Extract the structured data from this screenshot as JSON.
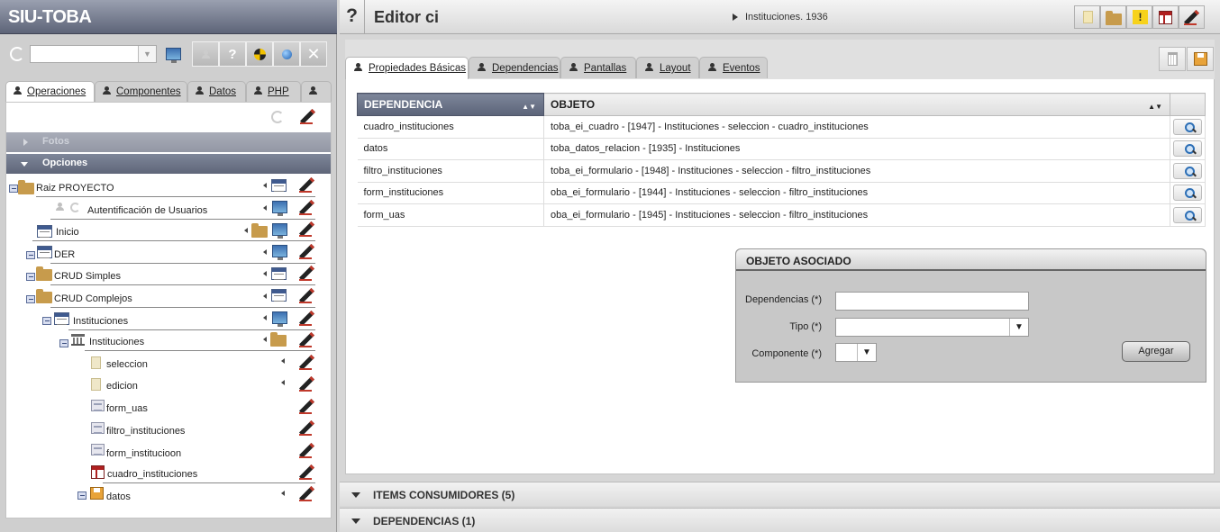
{
  "app": {
    "brand": "SIU-TOBA"
  },
  "left": {
    "tabs": [
      "Operaciones",
      "Componentes",
      "Datos",
      "PHP"
    ],
    "sections": {
      "fotos": "Fotos",
      "opciones": "Opciones"
    },
    "tree": [
      {
        "label": "Raiz PROYECTO"
      },
      {
        "label": "Autentificación de Usuarios"
      },
      {
        "label": "Inicio"
      },
      {
        "label": "DER"
      },
      {
        "label": "CRUD Simples"
      },
      {
        "label": "CRUD Complejos"
      },
      {
        "label": "Instituciones"
      },
      {
        "label": "Instituciones"
      },
      {
        "label": "seleccion"
      },
      {
        "label": "edicion"
      },
      {
        "label": "form_uas"
      },
      {
        "label": "filtro_instituciones"
      },
      {
        "label": "form_institucioon"
      },
      {
        "label": "cuadro_instituciones"
      },
      {
        "label": "datos"
      }
    ]
  },
  "header": {
    "help": "?",
    "title": "Editor ci",
    "breadcrumb": "Instituciones. 1936"
  },
  "tabs": [
    "Propiedades Básicas",
    "Dependencias",
    "Pantallas",
    "Layout",
    "Eventos"
  ],
  "table": {
    "columns": [
      "DEPENDENCIA",
      "OBJETO"
    ],
    "rows": [
      {
        "dep": "cuadro_instituciones",
        "obj": "toba_ei_cuadro - [1947] - Instituciones - seleccion - cuadro_instituciones"
      },
      {
        "dep": "datos",
        "obj": "toba_datos_relacion - [1935] - Instituciones"
      },
      {
        "dep": "filtro_instituciones",
        "obj": "toba_ei_formulario - [1948] - Instituciones - seleccion - filtro_instituciones"
      },
      {
        "dep": "form_instituciones",
        "obj": "oba_ei_formulario - [1944] - Instituciones - seleccion - filtro_instituciones"
      },
      {
        "dep": "form_uas",
        "obj": "oba_ei_formulario - [1945] - Instituciones - seleccion - filtro_instituciones"
      }
    ]
  },
  "assoc": {
    "title": "OBJETO ASOCIADO",
    "dep_label": "Dependencias (*)",
    "tipo_label": "Tipo (*)",
    "comp_label": "Componente (*)",
    "add_label": "Agregar"
  },
  "footer": {
    "items": "ITEMS CONSUMIDORES (5)",
    "deps": "DEPENDENCIAS (1)"
  }
}
